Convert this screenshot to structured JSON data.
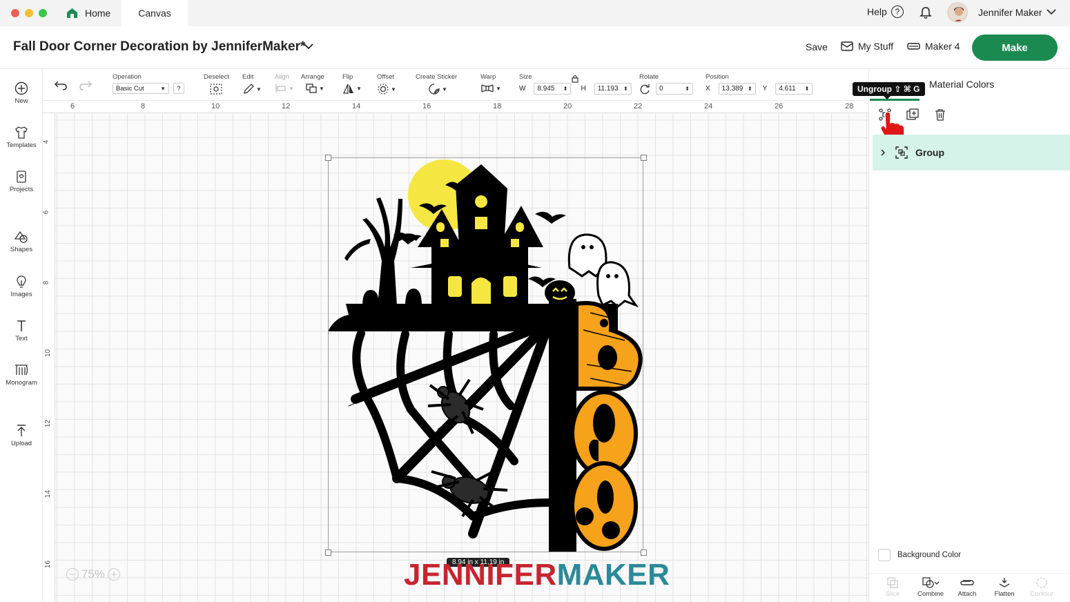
{
  "window": {
    "traffic_lights": [
      "#ee5f57",
      "#f6be33",
      "#3cc84a"
    ],
    "tabs": [
      {
        "label": "Home",
        "icon": "home-icon"
      },
      {
        "label": "Canvas"
      }
    ],
    "help_label": "Help",
    "help_icon_glyph": "?",
    "user_name": "Jennifer Maker"
  },
  "header": {
    "project_title": "Fall Door Corner Decoration by JenniferMaker*",
    "save_label": "Save",
    "mystuff_label": "My Stuff",
    "machine_label": "Maker 4",
    "make_label": "Make",
    "accent_color": "#1b8a51"
  },
  "sidebar": {
    "items": [
      {
        "label": "New",
        "icon": "plus-circle-icon"
      },
      {
        "label": "Templates",
        "icon": "shirt-icon"
      },
      {
        "label": "Projects",
        "icon": "projects-icon"
      },
      {
        "label": "Shapes",
        "icon": "shapes-icon"
      },
      {
        "label": "Images",
        "icon": "lightbulb-icon"
      },
      {
        "label": "Text",
        "icon": "text-icon"
      },
      {
        "label": "Monogram",
        "icon": "monogram-icon"
      },
      {
        "label": "Upload",
        "icon": "upload-icon"
      }
    ]
  },
  "toolbar": {
    "operation_label": "Operation",
    "operation_value": "Basic Cut",
    "operation_help": "?",
    "deselect_label": "Deselect",
    "edit_label": "Edit",
    "align_label": "Align",
    "arrange_label": "Arrange",
    "flip_label": "Flip",
    "offset_label": "Offset",
    "create_sticker_label": "Create Sticker",
    "warp_label": "Warp",
    "size_label": "Size",
    "size_w_axis": "W",
    "size_w_value": "8.945",
    "size_h_axis": "H",
    "size_h_value": "11.193",
    "rotate_label": "Rotate",
    "rotate_value": "0",
    "position_label": "Position",
    "position_x_axis": "X",
    "position_x_value": "13.389",
    "position_y_axis": "Y",
    "position_y_value": "4.611"
  },
  "canvas": {
    "ruler_top": [
      "6",
      "8",
      "10",
      "12",
      "14",
      "16",
      "18",
      "20",
      "22",
      "24",
      "26",
      "28"
    ],
    "ruler_left": [
      "4",
      "6",
      "8",
      "10",
      "12",
      "14",
      "16"
    ],
    "dimension_readout": "8.94 in x 11.19 in",
    "zoom_level": "75%",
    "zoom_out_glyph": "−",
    "zoom_in_glyph": "+",
    "watermark_part1": "JENNIFER",
    "watermark_part2": "MAKER",
    "watermark_colors": [
      "#c8242f",
      "#2a8a98"
    ]
  },
  "design_colors": {
    "black": "#000000",
    "moon": "#f5e642",
    "orange": "#f6a21b",
    "spider": "#2b2b2b",
    "ghost": "#ffffff"
  },
  "right_panel": {
    "tooltip": "Ungroup ⇧ ⌘ G",
    "material_colors_label": "Material Colors",
    "group_label": "Group",
    "group_row_color": "#d6f3ea",
    "background_color_label": "Background Color",
    "bottom_actions": [
      {
        "label": "Slice",
        "enabled": false
      },
      {
        "label": "Combine",
        "enabled": true
      },
      {
        "label": "Attach",
        "enabled": true
      },
      {
        "label": "Flatten",
        "enabled": true
      },
      {
        "label": "Contour",
        "enabled": false
      }
    ]
  }
}
